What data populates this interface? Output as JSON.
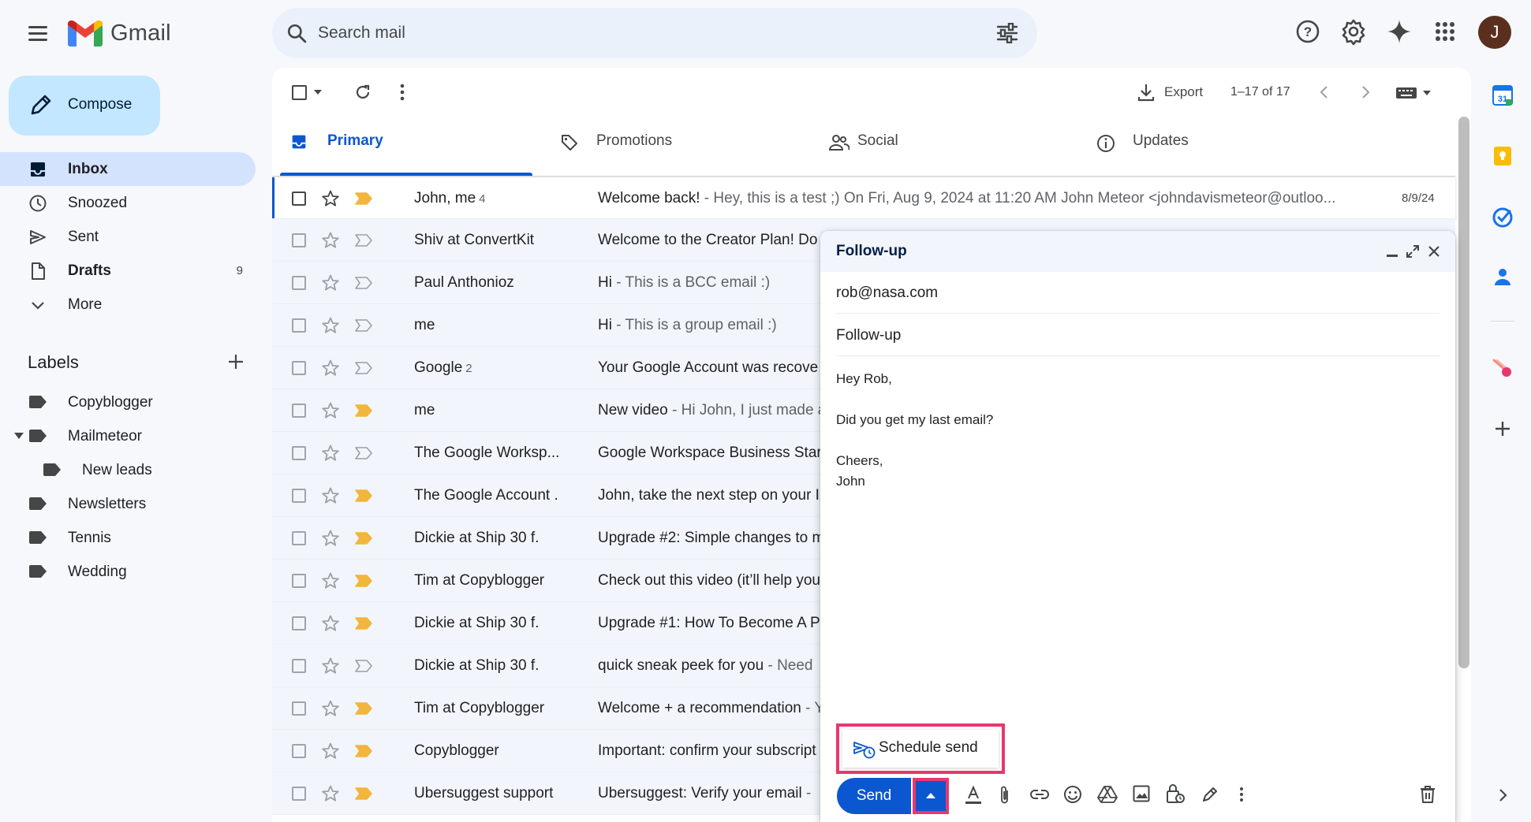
{
  "app": {
    "name": "Gmail",
    "avatar_initial": "J"
  },
  "search": {
    "placeholder": "Search mail"
  },
  "sidebar": {
    "compose_label": "Compose",
    "items": [
      {
        "label": "Inbox",
        "count": "",
        "active": true,
        "bold": true,
        "icon": "inbox-icon"
      },
      {
        "label": "Snoozed",
        "count": "",
        "active": false,
        "bold": false,
        "icon": "clock-icon"
      },
      {
        "label": "Sent",
        "count": "",
        "active": false,
        "bold": false,
        "icon": "send-icon"
      },
      {
        "label": "Drafts",
        "count": "9",
        "active": false,
        "bold": true,
        "icon": "draft-icon"
      },
      {
        "label": "More",
        "count": "",
        "active": false,
        "bold": false,
        "icon": "chevron-down-icon"
      }
    ],
    "labels_heading": "Labels",
    "labels": [
      {
        "name": "Copyblogger",
        "indent": 0,
        "expanded": false
      },
      {
        "name": "Mailmeteor",
        "indent": 0,
        "expanded": true
      },
      {
        "name": "New leads",
        "indent": 1,
        "expanded": false
      },
      {
        "name": "Newsletters",
        "indent": 0,
        "expanded": false
      },
      {
        "name": "Tennis",
        "indent": 0,
        "expanded": false
      },
      {
        "name": "Wedding",
        "indent": 0,
        "expanded": false
      }
    ]
  },
  "toolbar": {
    "export_label": "Export",
    "page_count": "1–17 of 17"
  },
  "tabs": [
    {
      "label": "Primary",
      "icon": "inbox-tab-icon",
      "active": true
    },
    {
      "label": "Promotions",
      "icon": "tag-icon",
      "active": false
    },
    {
      "label": "Social",
      "icon": "people-icon",
      "active": false
    },
    {
      "label": "Updates",
      "icon": "info-icon",
      "active": false
    }
  ],
  "emails": [
    {
      "sender": "John, me",
      "count": "4",
      "subject": "Welcome back!",
      "snippet": " - Hey, this is a test ;) On Fri, Aug 9, 2024 at 11:20 AM John Meteor <johndavismeteor@outloo...",
      "date": "8/9/24",
      "important": true,
      "starred": false
    },
    {
      "sender": "Shiv at ConvertKit",
      "count": "",
      "subject": "Welcome to the Creator Plan! Do",
      "snippet": "",
      "date": "",
      "important": false,
      "starred": false
    },
    {
      "sender": "Paul Anthonioz",
      "count": "",
      "subject": "Hi",
      "snippet": " - This is a BCC email :)",
      "date": "",
      "important": false,
      "starred": false
    },
    {
      "sender": "me",
      "count": "",
      "subject": "Hi",
      "snippet": " - This is a group email :)",
      "date": "",
      "important": false,
      "starred": false
    },
    {
      "sender": "Google",
      "count": "2",
      "subject": "Your Google Account was recove",
      "snippet": "",
      "date": "",
      "important": false,
      "starred": false
    },
    {
      "sender": "me",
      "count": "",
      "subject": "New video",
      "snippet": " - Hi John, I just made a",
      "date": "",
      "important": true,
      "starred": false
    },
    {
      "sender": "The Google Worksp...",
      "count": "",
      "subject": "Google Workspace Business Star",
      "snippet": "",
      "date": "",
      "important": false,
      "starred": false
    },
    {
      "sender": "The Google Account .",
      "count": "",
      "subject": "John, take the next step on your I",
      "snippet": "",
      "date": "",
      "important": true,
      "starred": false
    },
    {
      "sender": "Dickie at Ship 30 f.",
      "count": "",
      "subject": "Upgrade #2: Simple changes to m",
      "snippet": "",
      "date": "",
      "important": true,
      "starred": false
    },
    {
      "sender": "Tim at Copyblogger",
      "count": "",
      "subject": "Check out this video (it’ll help you",
      "snippet": "",
      "date": "",
      "important": true,
      "starred": false
    },
    {
      "sender": "Dickie at Ship 30 f.",
      "count": "",
      "subject": "Upgrade #1: How To Become A P",
      "snippet": "",
      "date": "",
      "important": true,
      "starred": false
    },
    {
      "sender": "Dickie at Ship 30 f.",
      "count": "",
      "subject": "quick sneak peek for you",
      "snippet": " - Need",
      "date": "",
      "important": false,
      "starred": false
    },
    {
      "sender": "Tim at Copyblogger",
      "count": "",
      "subject": "Welcome + a recommendation",
      "snippet": " - Y",
      "date": "",
      "important": true,
      "starred": false
    },
    {
      "sender": "Copyblogger",
      "count": "",
      "subject": "Important: confirm your subscript",
      "snippet": "",
      "date": "",
      "important": true,
      "starred": false
    },
    {
      "sender": "Ubersuggest support",
      "count": "",
      "subject": "Ubersuggest: Verify your email",
      "snippet": " - ",
      "date": "",
      "important": true,
      "starred": false
    }
  ],
  "compose_window": {
    "title": "Follow-up",
    "to": "rob@nasa.com",
    "subject": "Follow-up",
    "body_lines": [
      "Hey Rob,",
      "",
      "Did you get my last email?",
      "",
      "Cheers,",
      "John"
    ],
    "schedule_send_label": "Schedule send",
    "send_label": "Send"
  },
  "colors": {
    "accent": "#0b57d0",
    "highlight": "#e8386d",
    "important": "#f2b63d"
  }
}
